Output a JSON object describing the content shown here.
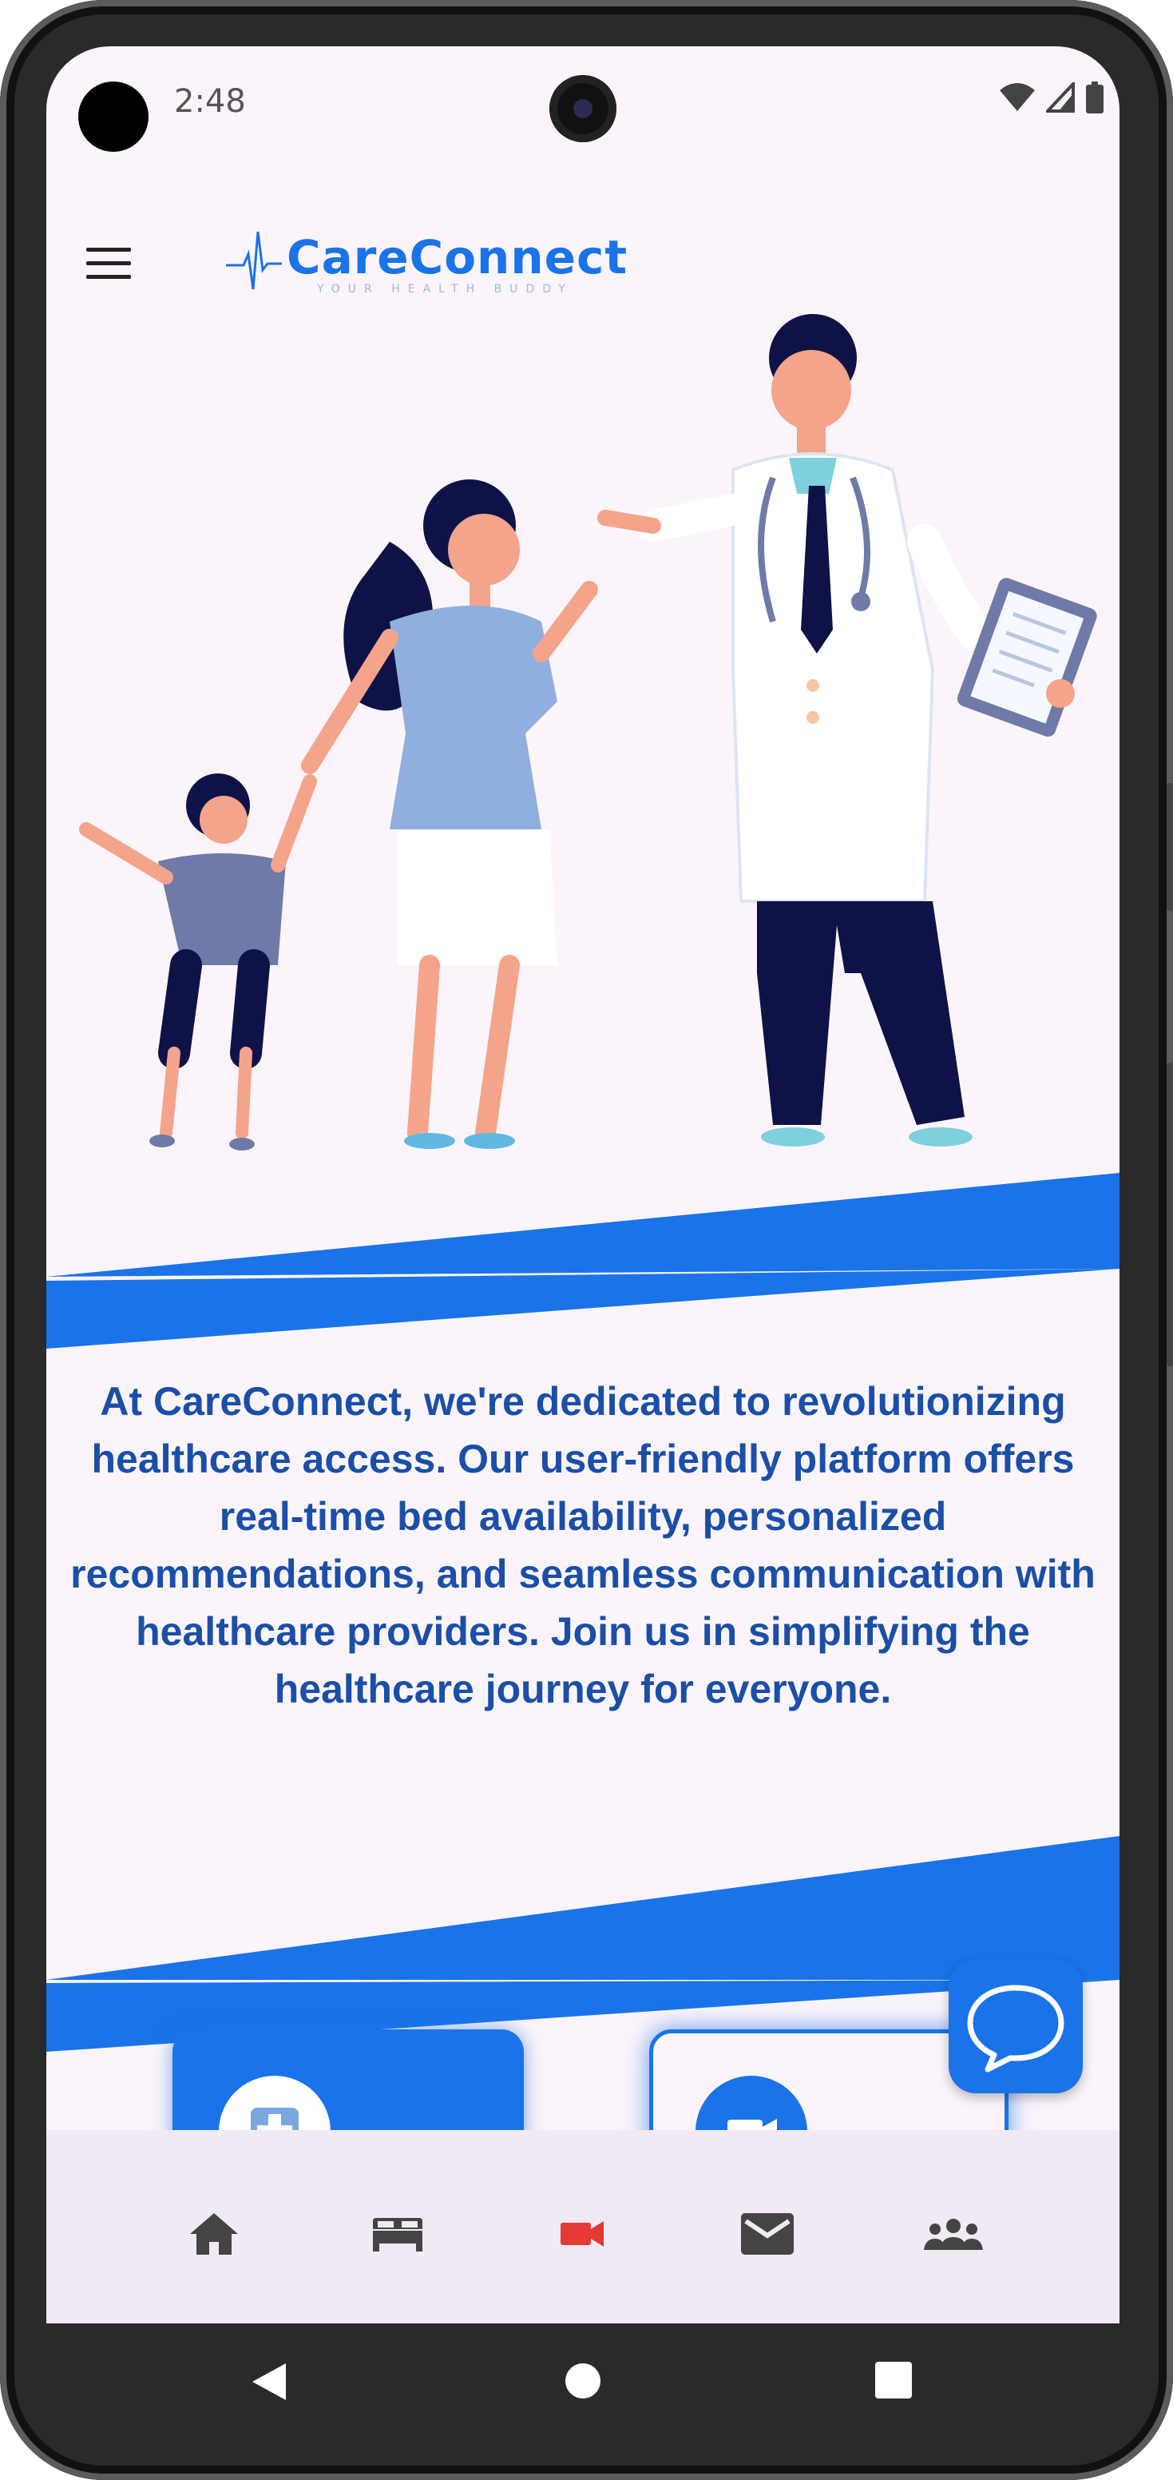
{
  "status_bar": {
    "time": "2:48",
    "icons": [
      "wifi-icon",
      "signal-icon",
      "battery-icon"
    ]
  },
  "app_bar": {
    "logo_text": "CareConnect",
    "tagline": "YOUR HEALTH BUDDY",
    "menu_icon": "hamburger-menu-icon"
  },
  "hero": {
    "illustration": "doctor-greeting-family-illustration"
  },
  "about": {
    "text": "At CareConnect, we're dedicated to revolutionizing healthcare access. Our user-friendly platform offers real-time bed availability, personalized recommendations, and seamless communication with healthcare providers. Join us in simplifying the healthcare journey for everyone."
  },
  "cards": [
    {
      "icon": "medical-cross-icon",
      "style": "filled"
    },
    {
      "icon": "video-camera-icon",
      "style": "outlined"
    }
  ],
  "chat_fab": {
    "icon": "chat-bubble-icon"
  },
  "bottom_nav": {
    "items": [
      {
        "icon": "home-icon",
        "active": false
      },
      {
        "icon": "bed-icon",
        "active": false
      },
      {
        "icon": "video-camera-icon",
        "active": true
      },
      {
        "icon": "mail-icon",
        "active": false
      },
      {
        "icon": "group-icon",
        "active": false
      }
    ]
  },
  "system_nav": [
    "back-icon",
    "home-circle-icon",
    "recents-icon"
  ],
  "colors": {
    "primary": "#1a73e8",
    "text_blue": "#1a4fa8",
    "background": "#fcf4fb",
    "nav_background": "#f1eaf5",
    "active_nav": "#e53935",
    "inactive_nav": "#444444"
  }
}
